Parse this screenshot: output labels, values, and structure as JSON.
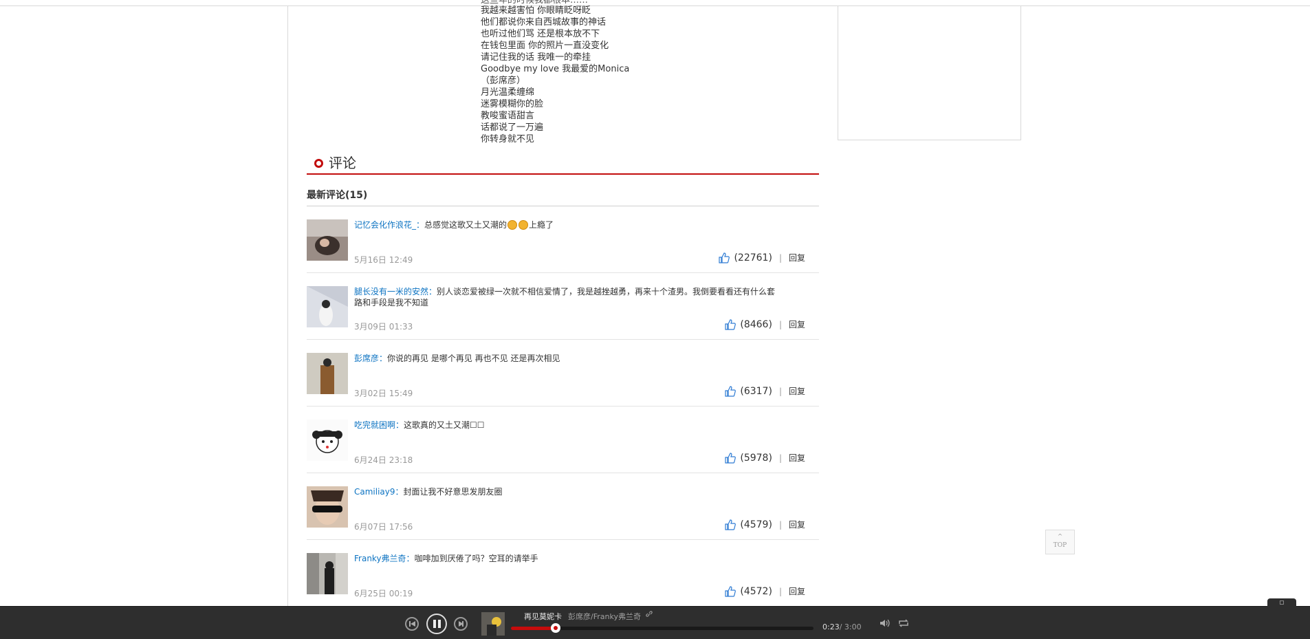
{
  "lyrics": {
    "cut_line": "这些年的时候我都根本……",
    "lines": [
      "我越来越害怕 你眼睛眨呀眨",
      "他们都说你来自西城故事的神话",
      "也听过他们骂 还是根本放不下",
      "在钱包里面 你的照片一直没变化",
      "请记住我的话 我唯一的牵挂",
      "Goodbye my love 我最爱的Monica",
      "（彭席彦）",
      "月光温柔缠绵",
      "迷雾模糊你的脸",
      "教唆蜜语甜言",
      "话都说了一万遍",
      "你转身就不见"
    ]
  },
  "comments": {
    "section_title": "评论",
    "latest_label": "最新评论(15)",
    "separator": "|",
    "items": [
      {
        "user": "记忆会化作浪花_",
        "colon": "：",
        "text": "总感觉这歌又土又潮的",
        "emoji_count": 2,
        "text_after": "上瘾了",
        "time": "5月16日 12:49",
        "likes": "(22761)",
        "reply": "回复"
      },
      {
        "user": "腿长没有一米的安然",
        "colon": "：",
        "text": "别人谈恋爱被绿一次就不相信爱情了，我是越挫越勇，再来十个渣男。我倒要看看还有什么套路和手段是我不知道",
        "time": "3月09日 01:33",
        "likes": "(8466)",
        "reply": "回复"
      },
      {
        "user": "彭席彦",
        "colon": "：",
        "text": "你说的再见 是哪个再见 再也不见 还是再次相见",
        "time": "3月02日 15:49",
        "likes": "(6317)",
        "reply": "回复"
      },
      {
        "user": "吃完就困啊",
        "colon": "：",
        "text": "这歌真的又土又潮☐☐",
        "time": "6月24日 23:18",
        "likes": "(5978)",
        "reply": "回复"
      },
      {
        "user": "Camiliay9",
        "colon": "：",
        "text": "封面让我不好意思发朋友圈",
        "time": "6月07日 17:56",
        "likes": "(4579)",
        "reply": "回复"
      },
      {
        "user": "Franky弗兰奇",
        "colon": "：",
        "text": "咖啡加到厌倦了吗？空耳的请举手",
        "time": "6月25日 00:19",
        "likes": "(4572)",
        "reply": "回复"
      }
    ]
  },
  "totop": {
    "arrow": "^",
    "label": "TOP"
  },
  "player": {
    "song": "再见莫妮卡",
    "artist": "彭席彦/Franky弗兰奇",
    "link_icon": "link-icon",
    "current": "0:23",
    "total": "/ 3:00",
    "progress": 0.147,
    "accent": "#c70c0c"
  }
}
